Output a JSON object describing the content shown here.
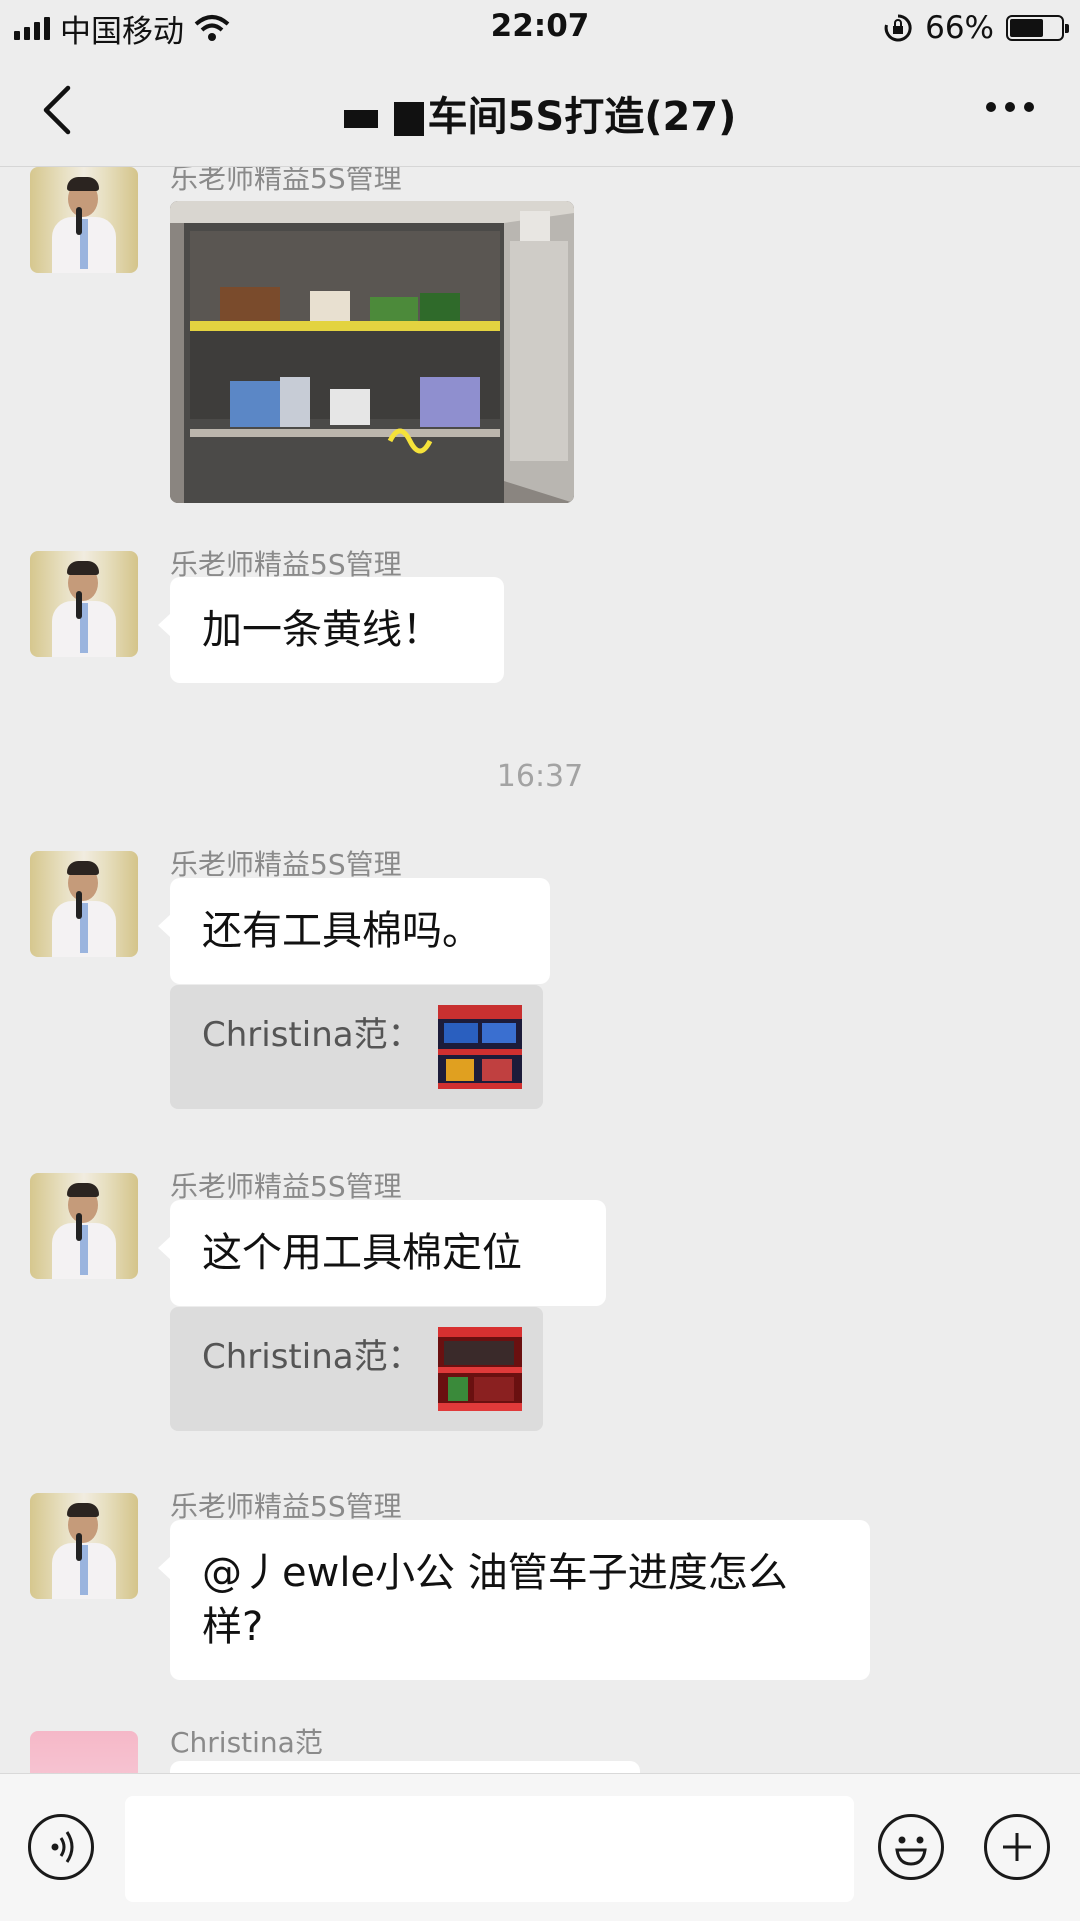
{
  "status_bar": {
    "carrier": "中国移动",
    "time": "22:07",
    "battery_percent": "66%",
    "battery_level": 0.66,
    "icons": [
      "signal-icon",
      "wifi-icon",
      "rotation-lock-icon",
      "battery-icon"
    ]
  },
  "nav": {
    "title": "车间5S打造(27)",
    "back_icon": "chevron-left-icon",
    "more_icon": "more-dots-icon"
  },
  "messages": [
    {
      "type": "image",
      "sender": "乐老师精益5S管理",
      "image_desc": "cabinet-photo"
    },
    {
      "type": "text",
      "sender": "乐老师精益5S管理",
      "text": "加一条黄线！"
    },
    {
      "type": "time",
      "text": "16:37"
    },
    {
      "type": "text",
      "sender": "乐老师精益5S管理",
      "text": "还有工具棉吗。",
      "quote": {
        "label": "Christina范："
      }
    },
    {
      "type": "text",
      "sender": "乐老师精益5S管理",
      "text": "这个用工具棉定位",
      "quote": {
        "label": "Christina范："
      }
    },
    {
      "type": "text",
      "sender": "乐老师精益5S管理",
      "text": "@丿ewle小公 油管车子进度怎么样?"
    },
    {
      "type": "text",
      "sender": "Christina范",
      "text": ""
    }
  ],
  "input_bar": {
    "voice_icon": "voice-icon",
    "emoji_icon": "emoji-icon",
    "plus_icon": "plus-icon",
    "text_value": ""
  }
}
